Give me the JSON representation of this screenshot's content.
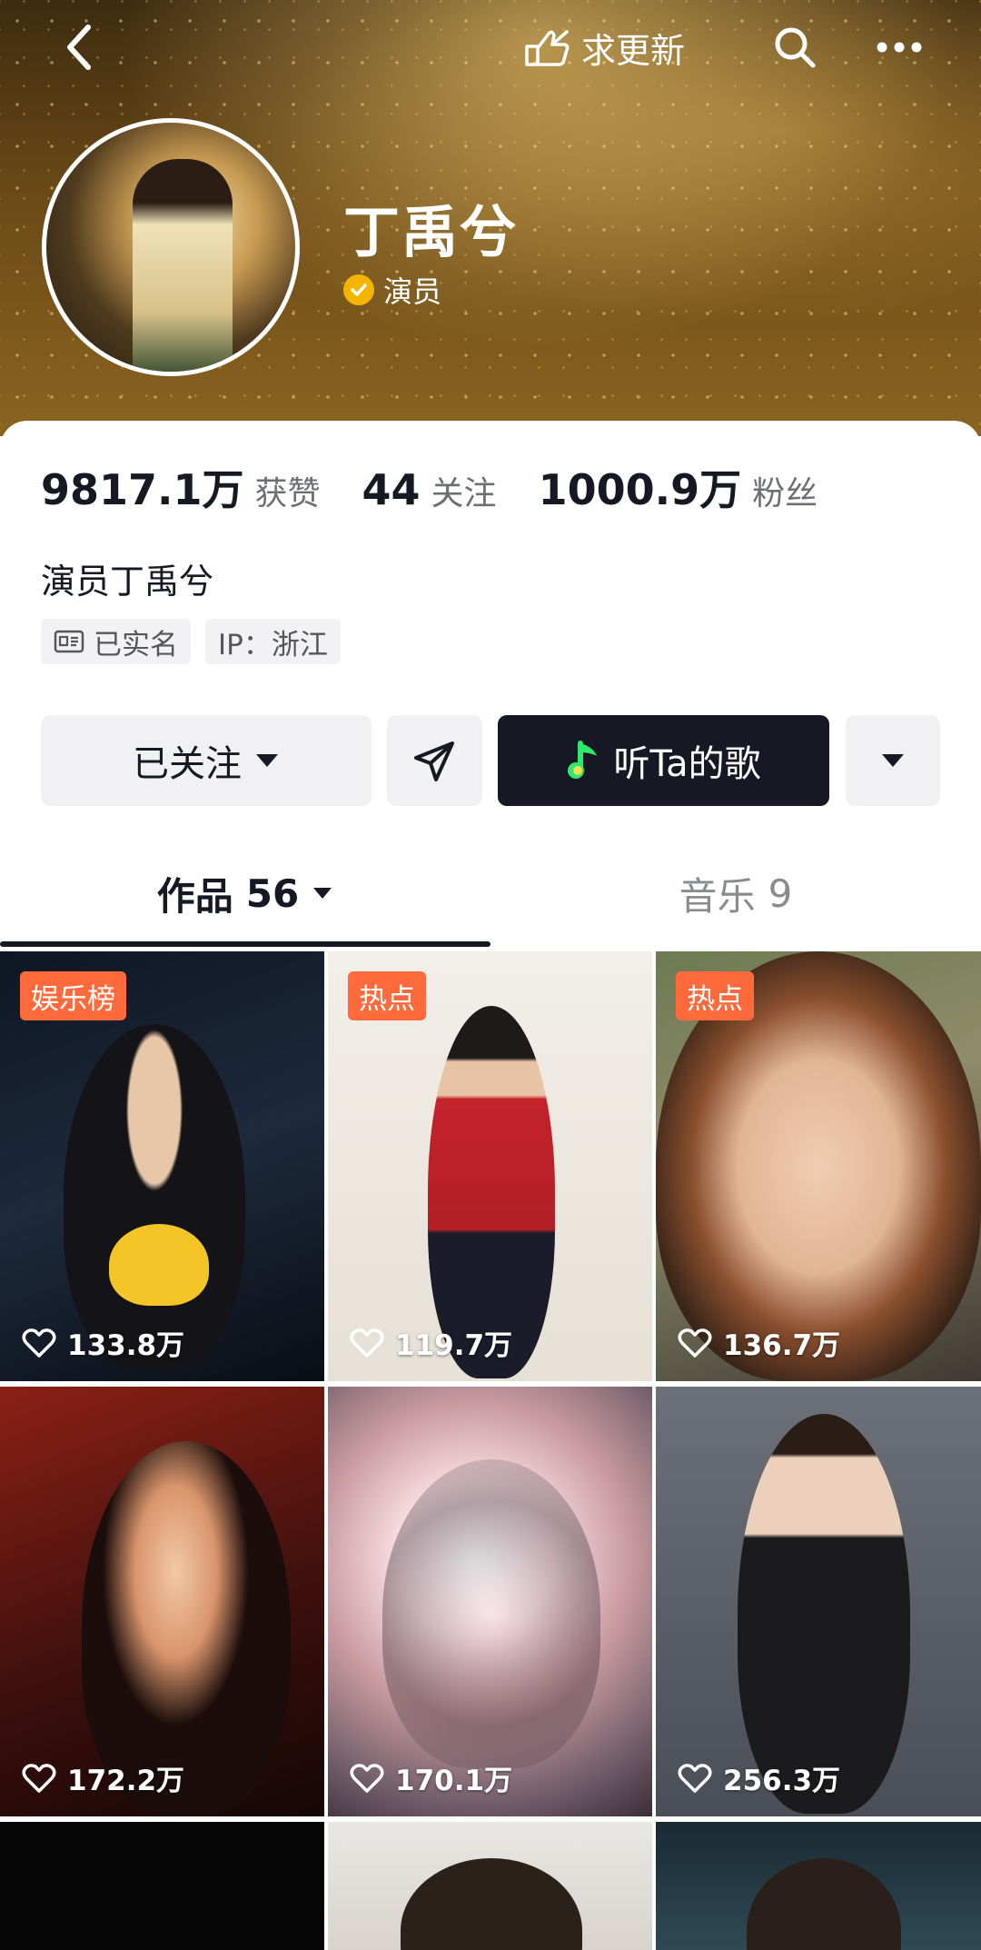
{
  "header": {
    "update_label": "求更新",
    "icons": {
      "back": "chevron-left-icon",
      "update": "pointing-hand-icon",
      "search": "search-icon",
      "more": "more-dots-icon"
    }
  },
  "profile": {
    "name": "丁禹兮",
    "verified_label": "演员",
    "stats": [
      {
        "value": "9817.1万",
        "label": "获赞"
      },
      {
        "value": "44",
        "label": "关注"
      },
      {
        "value": "1000.9万",
        "label": "粉丝"
      }
    ],
    "bio": "演员丁禹兮",
    "chips": [
      {
        "label": "已实名",
        "icon": "id-card-icon"
      },
      {
        "label": "IP：浙江"
      }
    ]
  },
  "actions": {
    "follow_label": "已关注",
    "listen_label": "听Ta的歌"
  },
  "tabs": {
    "works_label": "作品",
    "works_count": "56",
    "music_label": "音乐",
    "music_count": "9"
  },
  "videos": [
    {
      "tag": "娱乐榜",
      "likes": "133.8万"
    },
    {
      "tag": "热点",
      "likes": "119.7万"
    },
    {
      "tag": "热点",
      "likes": "136.7万"
    },
    {
      "tag": "",
      "likes": "172.2万"
    },
    {
      "tag": "",
      "likes": "170.1万"
    },
    {
      "tag": "",
      "likes": "256.3万"
    }
  ],
  "colors": {
    "accent_dark": "#161823",
    "hot_tag": "#ff6a3c",
    "verified_badge": "#f5b400",
    "music_note": "#2ee86e"
  }
}
